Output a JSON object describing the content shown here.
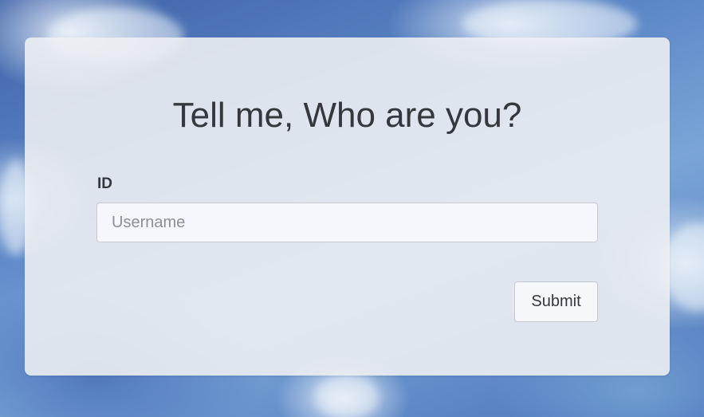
{
  "form": {
    "title": "Tell me, Who are you?",
    "id_label": "ID",
    "username_placeholder": "Username",
    "username_value": "",
    "submit_label": "Submit"
  }
}
